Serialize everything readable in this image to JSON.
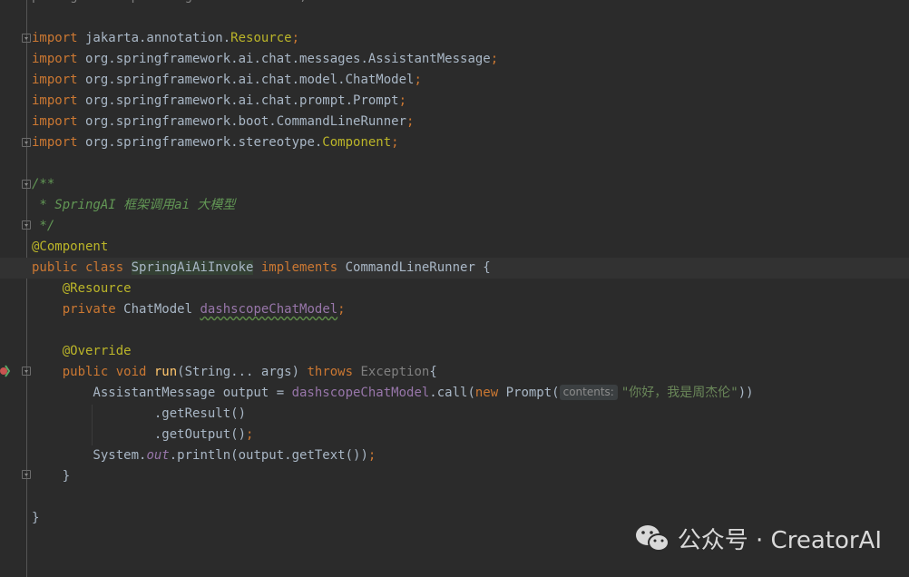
{
  "lines": [
    {
      "segs": [
        {
          "t": "package com.spai.aiagent.demoinvoke;",
          "c": "grey"
        }
      ]
    },
    {
      "segs": []
    },
    {
      "segs": [
        {
          "t": "import",
          "c": "kw"
        },
        {
          "t": " jakarta.annotation.",
          "c": "pkg"
        },
        {
          "t": "Resource",
          "c": "yellowclass"
        },
        {
          "t": ";",
          "c": "semi"
        }
      ]
    },
    {
      "segs": [
        {
          "t": "import",
          "c": "kw"
        },
        {
          "t": " org.springframework.ai.chat.messages.AssistantMessage",
          "c": "pkg"
        },
        {
          "t": ";",
          "c": "semi"
        }
      ]
    },
    {
      "segs": [
        {
          "t": "import",
          "c": "kw"
        },
        {
          "t": " org.springframework.ai.chat.model.ChatModel",
          "c": "pkg"
        },
        {
          "t": ";",
          "c": "semi"
        }
      ]
    },
    {
      "segs": [
        {
          "t": "import",
          "c": "kw"
        },
        {
          "t": " org.springframework.ai.chat.prompt.Prompt",
          "c": "pkg"
        },
        {
          "t": ";",
          "c": "semi"
        }
      ]
    },
    {
      "segs": [
        {
          "t": "import",
          "c": "kw"
        },
        {
          "t": " org.springframework.boot.CommandLineRunner",
          "c": "pkg"
        },
        {
          "t": ";",
          "c": "semi"
        }
      ]
    },
    {
      "segs": [
        {
          "t": "import",
          "c": "kw"
        },
        {
          "t": " org.springframework.stereotype.",
          "c": "pkg"
        },
        {
          "t": "Component",
          "c": "yellowclass"
        },
        {
          "t": ";",
          "c": "semi"
        }
      ]
    },
    {
      "segs": []
    },
    {
      "segs": [
        {
          "t": "/**",
          "c": "doc"
        }
      ]
    },
    {
      "segs": [
        {
          "t": " * SpringAI 框架调用ai 大模型",
          "c": "doc"
        }
      ]
    },
    {
      "segs": [
        {
          "t": " */",
          "c": "doc"
        }
      ]
    },
    {
      "segs": [
        {
          "t": "@Component",
          "c": "ann"
        }
      ]
    },
    {
      "current": true,
      "segs": [
        {
          "t": "public class ",
          "c": "kw"
        },
        {
          "t": "SpringAiAiInvoke",
          "c": "hl-class"
        },
        {
          "t": " implements ",
          "c": "kw"
        },
        {
          "t": "CommandLineRunner {",
          "c": ""
        }
      ]
    },
    {
      "segs": [
        {
          "t": "    ",
          "c": ""
        },
        {
          "t": "@Resource",
          "c": "ann"
        }
      ]
    },
    {
      "segs": [
        {
          "t": "    ",
          "c": ""
        },
        {
          "t": "private ",
          "c": "kw"
        },
        {
          "t": "ChatModel ",
          "c": ""
        },
        {
          "t": "dashscopeChatModel",
          "c": "field-wavy"
        },
        {
          "t": ";",
          "c": "semi"
        }
      ]
    },
    {
      "segs": []
    },
    {
      "segs": [
        {
          "t": "    ",
          "c": ""
        },
        {
          "t": "@Override",
          "c": "ann"
        }
      ]
    },
    {
      "segs": [
        {
          "t": "    ",
          "c": ""
        },
        {
          "t": "public void ",
          "c": "kw"
        },
        {
          "t": "run",
          "c": "method-decl"
        },
        {
          "t": "(String... args) ",
          "c": ""
        },
        {
          "t": "throws ",
          "c": "kw"
        },
        {
          "t": "Exception",
          "c": "grey"
        },
        {
          "t": "{",
          "c": ""
        }
      ]
    },
    {
      "segs": [
        {
          "t": "        AssistantMessage output = ",
          "c": ""
        },
        {
          "t": "dashscopeChatModel",
          "c": "field"
        },
        {
          "t": ".call(",
          "c": ""
        },
        {
          "t": "new ",
          "c": "kw"
        },
        {
          "t": "Prompt(",
          "c": ""
        },
        {
          "hint": "contents:"
        },
        {
          "t": "\"你好，我是周杰伦\"",
          "c": "str"
        },
        {
          "t": "))",
          "c": ""
        }
      ]
    },
    {
      "segs": [
        {
          "t": "                .getResult()",
          "c": ""
        }
      ]
    },
    {
      "segs": [
        {
          "t": "                .getOutput()",
          "c": ""
        },
        {
          "t": ";",
          "c": "semi"
        }
      ]
    },
    {
      "segs": [
        {
          "t": "        System.",
          "c": ""
        },
        {
          "t": "out",
          "c": "static-field"
        },
        {
          "t": ".println(output.getText())",
          "c": ""
        },
        {
          "t": ";",
          "c": "semi"
        }
      ]
    },
    {
      "segs": [
        {
          "t": "    }",
          "c": ""
        }
      ]
    },
    {
      "segs": []
    },
    {
      "segs": [
        {
          "t": "}",
          "c": ""
        }
      ]
    }
  ],
  "watermark": {
    "label": "公众号 · CreatorAI"
  }
}
